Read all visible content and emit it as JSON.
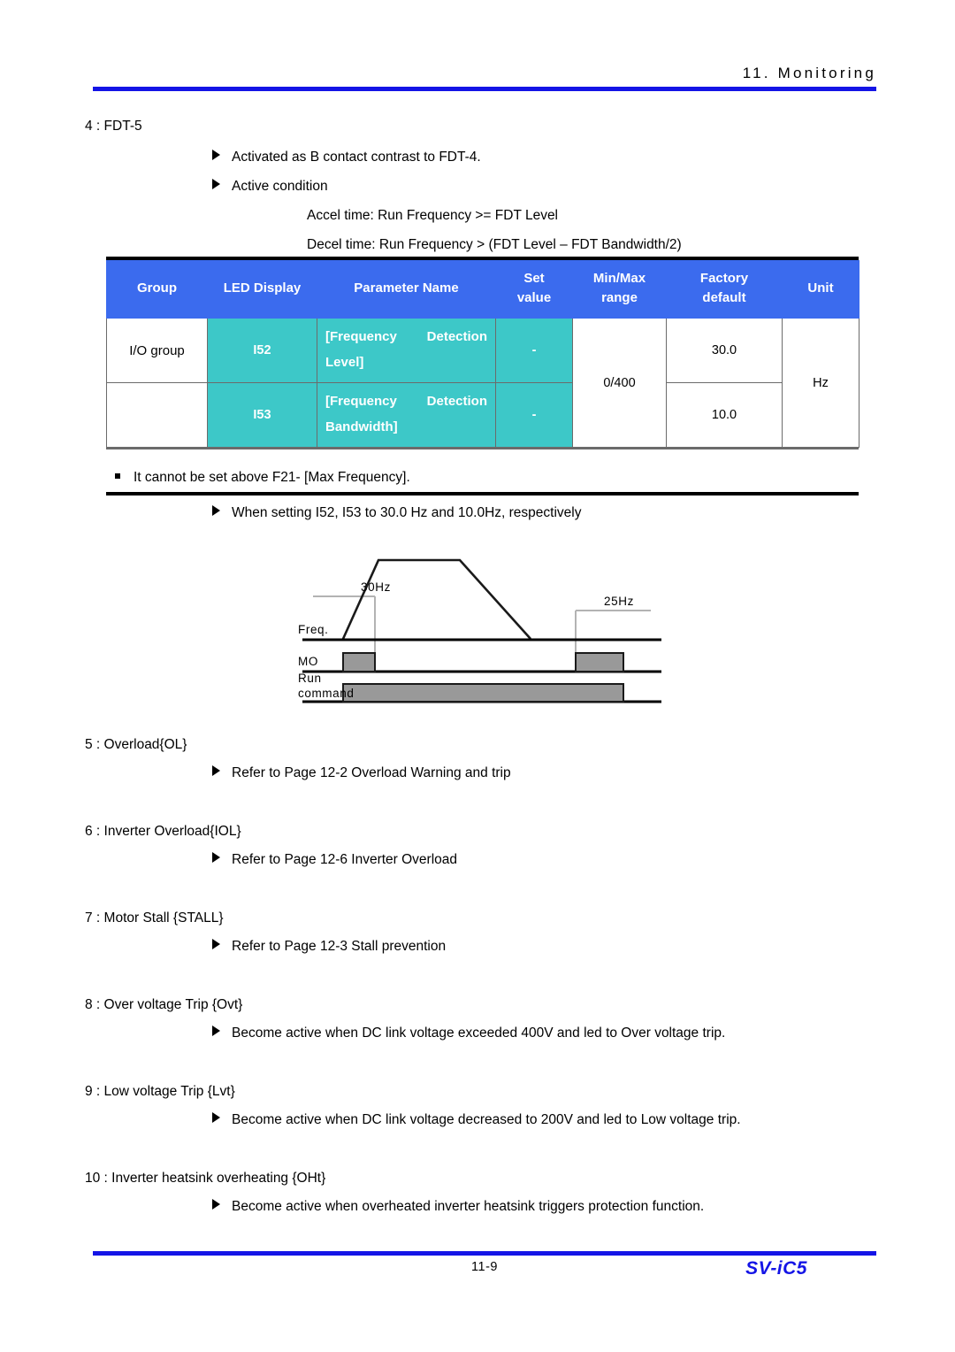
{
  "header": {
    "title": "11. Monitoring"
  },
  "section4": {
    "heading": "4 : FDT-5",
    "bullets": [
      "Activated as B contact contrast to FDT-4.",
      "Active condition"
    ],
    "conditions": [
      "Accel time: Run Frequency >= FDT Level",
      "Decel time: Run Frequency > (FDT Level – FDT Bandwidth/2)"
    ]
  },
  "table": {
    "headers": {
      "group": "Group",
      "led_display": "LED Display",
      "parameter_name": "Parameter Name",
      "set_value_line1": "Set",
      "set_value_line2": "value",
      "min_max_line1": "Min/Max",
      "min_max_line2": "range",
      "factory_line1": "Factory",
      "factory_line2": "default",
      "unit": "Unit"
    },
    "group_label": "I/O group",
    "min_max_range": "0/400",
    "unit": "Hz",
    "rows": [
      {
        "led": "I52",
        "param_a": "[Frequency",
        "param_b": "Detection",
        "param_c": "Level]",
        "set_value": "-",
        "factory_default": "30.0"
      },
      {
        "led": "I53",
        "param_a": "[Frequency",
        "param_b": "Detection",
        "param_c": "Bandwidth]",
        "set_value": "-",
        "factory_default": "10.0"
      }
    ]
  },
  "note": "It cannot be set above F21- [Max Frequency].",
  "diagram_note": "When setting I52, I53 to 30.0 Hz and 10.0Hz, respectively",
  "diagram": {
    "label_30hz": "30Hz",
    "label_25hz": "25Hz",
    "label_freq": "Freq.",
    "label_mo": "MO",
    "label_run_1": "Run",
    "label_run_2": "command"
  },
  "sections": [
    {
      "heading": "5 : Overload{OL}",
      "bullet": "Refer to Page 12-2 Overload Warning and trip"
    },
    {
      "heading": "6 : Inverter Overload{IOL}",
      "bullet": "Refer to Page 12-6 Inverter Overload"
    },
    {
      "heading": "7 : Motor Stall {STALL}",
      "bullet": "Refer to Page 12-3 Stall prevention"
    },
    {
      "heading": "8 : Over voltage Trip {Ovt}",
      "bullet": "Become active when DC link voltage exceeded 400V and led to Over voltage trip."
    },
    {
      "heading": "9 : Low voltage Trip {Lvt}",
      "bullet": "Become active when DC link voltage decreased to 200V and led to Low voltage trip."
    },
    {
      "heading": "10 : Inverter heatsink overheating {OHt}",
      "bullet": "Become active when overheated inverter heatsink triggers protection function."
    }
  ],
  "footer": {
    "page_number": "11-9",
    "model": "SV-iC5"
  },
  "colors": {
    "rule_blue": "#1414e6",
    "header_blue": "#3B6BEE",
    "cell_teal": "#3DC8C8",
    "bar_gray": "#999999"
  }
}
